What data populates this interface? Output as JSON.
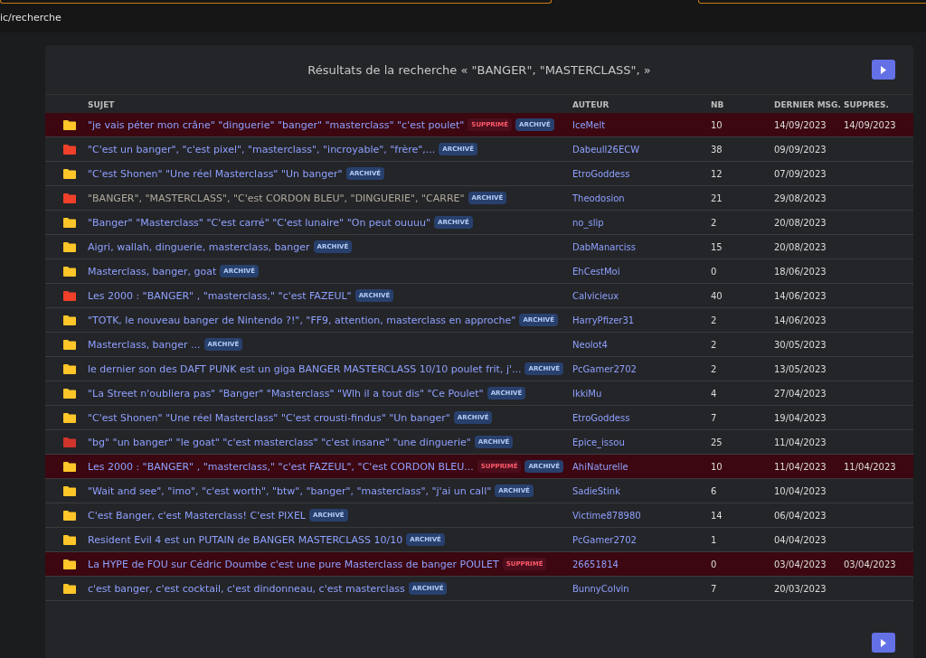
{
  "breadcrumb": "ic/recherche",
  "title": "Résultats de la recherche « \"BANGER\", \"MASTERCLASS\", »",
  "columns": [
    "SUJET",
    "AUTEUR",
    "NB",
    "DERNIER MSG.",
    "SUPPRES."
  ],
  "rows": [
    {
      "color": "#ffc629",
      "subject": "\"je vais péter mon crâne\" \"dinguerie\" \"banger\" \"masterclass\" \"c'est poulet\"",
      "visited": false,
      "deleted": true,
      "badges": [
        {
          "kind": "deleted",
          "label": "SUPPRIMÉ"
        },
        {
          "kind": "archived",
          "label": "ARCHIVÉ"
        }
      ],
      "author": "IceMelt",
      "nb": "10",
      "last": "14/09/2023",
      "deleted_on": "14/09/2023"
    },
    {
      "color": "#f0402a",
      "subject": "\"C'est un banger\", \"c'est pixel\", \"masterclass\", \"incroyable\", \"frère\",...",
      "visited": false,
      "deleted": false,
      "badges": [
        {
          "kind": "archived",
          "label": "ARCHIVÉ"
        }
      ],
      "author": "Dabeull26ECW",
      "nb": "38",
      "last": "09/09/2023"
    },
    {
      "color": "#ffc629",
      "subject": "\"C'est Shonen\" \"Une réel Masterclass\" \"Un banger\"",
      "visited": false,
      "deleted": false,
      "badges": [
        {
          "kind": "archived",
          "label": "ARCHIVÉ"
        }
      ],
      "author": "EtroGoddess",
      "nb": "12",
      "last": "07/09/2023"
    },
    {
      "color": "#f0402a",
      "subject": "\"BANGER\", \"MASTERCLASS\", \"C'est CORDON BLEU\", \"DINGUERIE\", \"CARRE\"",
      "visited": true,
      "deleted": false,
      "badges": [
        {
          "kind": "archived",
          "label": "ARCHIVÉ"
        }
      ],
      "author": "Theodosion",
      "nb": "21",
      "last": "29/08/2023"
    },
    {
      "color": "#ffc629",
      "subject": "\"Banger\" \"Masterclass\" \"C'est carré\" \"C'est lunaire\" \"On peut ouuuu\"",
      "visited": false,
      "deleted": false,
      "badges": [
        {
          "kind": "archived",
          "label": "ARCHIVÉ"
        }
      ],
      "author": "no_slip",
      "nb": "2",
      "last": "20/08/2023"
    },
    {
      "color": "#ffc629",
      "subject": "Aigri, wallah, dinguerie, masterclass, banger",
      "visited": false,
      "deleted": false,
      "badges": [
        {
          "kind": "archived",
          "label": "ARCHIVÉ"
        }
      ],
      "author": "DabManarciss",
      "nb": "15",
      "last": "20/08/2023"
    },
    {
      "color": "#ffc629",
      "subject": "Masterclass, banger, goat",
      "visited": false,
      "deleted": false,
      "badges": [
        {
          "kind": "archived",
          "label": "ARCHIVÉ"
        }
      ],
      "author": "EhCestMoi",
      "nb": "0",
      "last": "18/06/2023"
    },
    {
      "color": "#f0402a",
      "subject": "Les 2000 : \"BANGER\" , \"masterclass,\" \"c'est FAZEUL\"",
      "visited": false,
      "deleted": false,
      "badges": [
        {
          "kind": "archived",
          "label": "ARCHIVÉ"
        }
      ],
      "author": "Calvicieux",
      "nb": "40",
      "last": "14/06/2023"
    },
    {
      "color": "#ffc629",
      "subject": "\"TOTK, le nouveau banger de Nintendo ?!\", \"FF9, attention, masterclass en approche\"",
      "visited": false,
      "deleted": false,
      "badges": [
        {
          "kind": "archived",
          "label": "ARCHIVÉ"
        }
      ],
      "author": "HarryPfizer31",
      "nb": "2",
      "last": "14/06/2023"
    },
    {
      "color": "#ffc629",
      "subject": "Masterclass, banger ...",
      "visited": false,
      "deleted": false,
      "badges": [
        {
          "kind": "archived",
          "label": "ARCHIVÉ"
        }
      ],
      "author": "Neolot4",
      "nb": "2",
      "last": "30/05/2023"
    },
    {
      "color": "#ffc629",
      "subject": "le dernier son des DAFT PUNK est un giga BANGER MASTERCLASS 10/10 poulet frit, j'...",
      "visited": false,
      "deleted": false,
      "badges": [
        {
          "kind": "archived",
          "label": "ARCHIVÉ"
        }
      ],
      "author": "PcGamer2702",
      "nb": "2",
      "last": "13/05/2023"
    },
    {
      "color": "#ffc629",
      "subject": "\"La Street n'oubliera pas\" \"Banger\" \"Masterclass\" \"Wlh il a tout dis\" \"Ce Poulet\"",
      "visited": false,
      "deleted": false,
      "badges": [
        {
          "kind": "archived",
          "label": "ARCHIVÉ"
        }
      ],
      "author": "IkkiMu",
      "nb": "4",
      "last": "27/04/2023"
    },
    {
      "color": "#ffc629",
      "subject": "\"C'est Shonen\" \"Une réel Masterclass\" \"C'est crousti-findus\" \"Un banger\"",
      "visited": false,
      "deleted": false,
      "badges": [
        {
          "kind": "archived",
          "label": "ARCHIVÉ"
        }
      ],
      "author": "EtroGoddess",
      "nb": "7",
      "last": "19/04/2023"
    },
    {
      "color": "#d0342c",
      "subject": "\"bg\" \"un banger\" \"le goat\" \"c'est masterclass\" \"c'est insane\" \"une dinguerie\"",
      "visited": false,
      "deleted": false,
      "badges": [
        {
          "kind": "archived",
          "label": "ARCHIVÉ"
        }
      ],
      "author": "Epice_issou",
      "nb": "25",
      "last": "11/04/2023"
    },
    {
      "color": "#ffc629",
      "subject": "Les 2000 : \"BANGER\" , \"masterclass,\" \"c'est FAZEUL\", \"C'est CORDON BLEU...",
      "visited": false,
      "deleted": true,
      "badges": [
        {
          "kind": "deleted",
          "label": "SUPPRIMÉ"
        },
        {
          "kind": "archived",
          "label": "ARCHIVÉ"
        }
      ],
      "author": "AhiNaturelle",
      "nb": "10",
      "last": "11/04/2023",
      "deleted_on": "11/04/2023"
    },
    {
      "color": "#ffc629",
      "subject": "\"Wait and see\", \"imo\", \"c'est worth\", \"btw\", \"banger\", \"masterclass\", \"j'ai un call\"",
      "visited": false,
      "deleted": false,
      "badges": [
        {
          "kind": "archived",
          "label": "ARCHIVÉ"
        }
      ],
      "author": "SadieStink",
      "nb": "6",
      "last": "10/04/2023"
    },
    {
      "color": "#ffc629",
      "subject": "C'est Banger, c'est Masterclass! C'est PIXEL",
      "visited": false,
      "deleted": false,
      "badges": [
        {
          "kind": "archived",
          "label": "ARCHIVÉ"
        }
      ],
      "author": "Victime878980",
      "nb": "14",
      "last": "06/04/2023"
    },
    {
      "color": "#ffc629",
      "subject": "Resident Evil 4 est un PUTAIN de BANGER MASTERCLASS 10/10",
      "visited": false,
      "deleted": false,
      "badges": [
        {
          "kind": "archived",
          "label": "ARCHIVÉ"
        }
      ],
      "author": "PcGamer2702",
      "nb": "1",
      "last": "04/04/2023"
    },
    {
      "color": "#ffc629",
      "subject": "La HYPE de FOU sur Cédric Doumbe c'est une pure Masterclass de banger POULET",
      "visited": false,
      "deleted": true,
      "badges": [
        {
          "kind": "deleted",
          "label": "SUPPRIMÉ"
        }
      ],
      "author": "26651814",
      "nb": "0",
      "last": "03/04/2023",
      "deleted_on": "03/04/2023"
    },
    {
      "color": "#ffc629",
      "subject": "c'est banger, c'est cocktail, c'est dindonneau, c'est masterclass",
      "visited": false,
      "deleted": false,
      "badges": [
        {
          "kind": "archived",
          "label": "ARCHIVÉ"
        }
      ],
      "author": "BunnyColvin",
      "nb": "7",
      "last": "20/03/2023"
    }
  ]
}
